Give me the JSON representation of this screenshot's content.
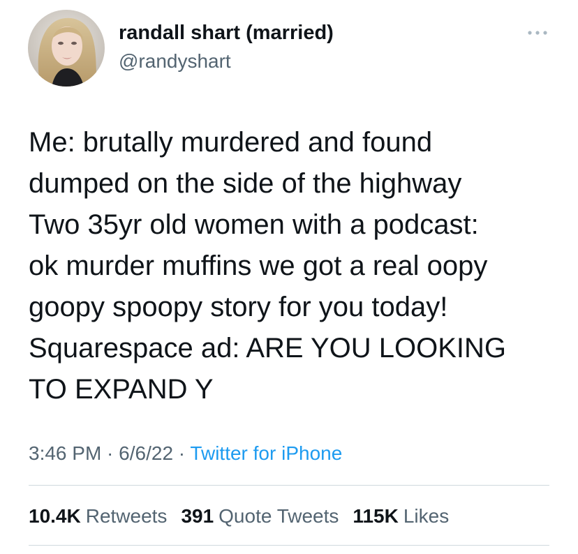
{
  "author": {
    "display_name": "randall shart (married)",
    "handle": "@randyshart",
    "avatar_icon": "user-avatar-photo"
  },
  "more_icon": "ellipsis-icon",
  "tweet": {
    "text": "Me: brutally murdered and found\ndumped on the side of the highway\nTwo 35yr old women with a podcast:\nok murder muffins we got a real oopy\ngoopy spoopy story for you today!\nSquarespace ad: ARE YOU LOOKING\nTO EXPAND Y",
    "time": "3:46 PM",
    "separator": " · ",
    "date": "6/6/22",
    "source": "Twitter for iPhone"
  },
  "stats": {
    "retweets_count": "10.4K",
    "retweets_label": "Retweets",
    "quotes_count": "391",
    "quotes_label": "Quote Tweets",
    "likes_count": "115K",
    "likes_label": "Likes"
  },
  "colors": {
    "text_primary": "#0f1419",
    "text_secondary": "#536471",
    "link": "#1d9bf0",
    "divider": "#cfd9de",
    "more_icon": "#aab8c2"
  }
}
